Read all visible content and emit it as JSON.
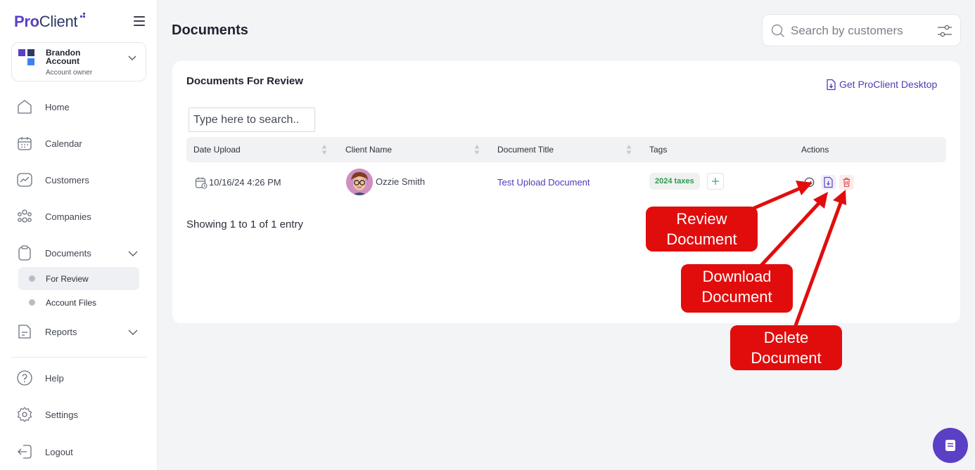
{
  "brand": {
    "pro": "Pro",
    "client": "Client"
  },
  "account": {
    "name": "Brandon Account",
    "role": "Account owner"
  },
  "nav": {
    "home": "Home",
    "calendar": "Calendar",
    "customers": "Customers",
    "companies": "Companies",
    "documents": "Documents",
    "for_review": "For Review",
    "account_files": "Account Files",
    "reports": "Reports",
    "help": "Help",
    "settings": "Settings",
    "logout": "Logout"
  },
  "header": {
    "title": "Documents",
    "search_placeholder": "Search by customers"
  },
  "card": {
    "title": "Documents For Review",
    "desktop_link": "Get ProClient Desktop",
    "search_placeholder": "Type here to search.."
  },
  "table": {
    "columns": [
      "Date Upload",
      "Client Name",
      "Document Title",
      "Tags",
      "Actions"
    ],
    "rows": [
      {
        "date": "10/16/24 4:26 PM",
        "client": "Ozzie Smith",
        "title": "Test Upload Document",
        "tag": "2024 taxes"
      }
    ],
    "footer": "Showing 1 to 1 of 1 entry"
  },
  "annotations": {
    "review": "Review Document",
    "download": "Download Document",
    "delete": "Delete Document"
  },
  "colors": {
    "accent": "#5b3fc4",
    "callout": "#e10d0d",
    "tag_text": "#2f9a55"
  }
}
